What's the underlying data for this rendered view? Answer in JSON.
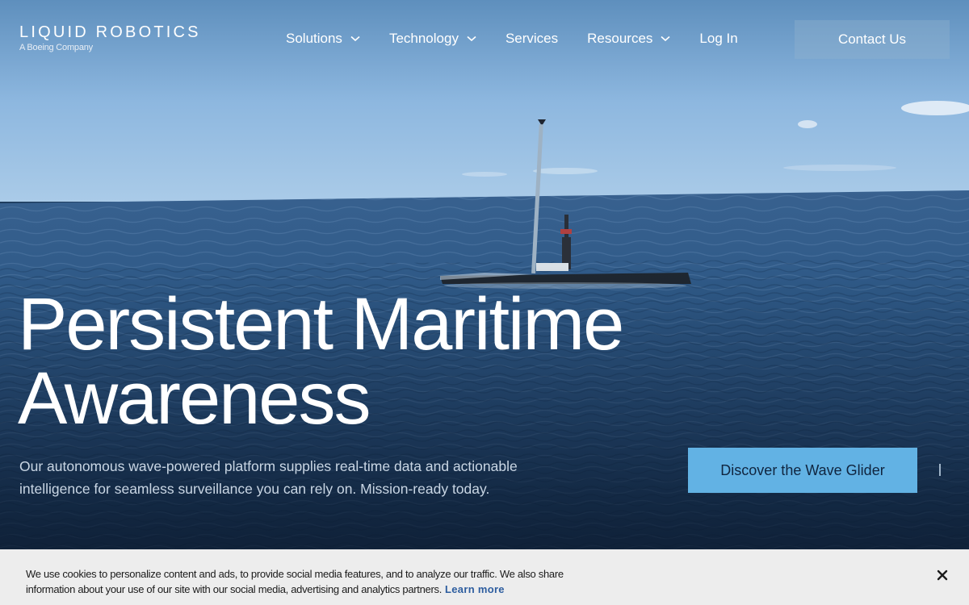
{
  "brand": {
    "name": "LIQUID ROBOTICS",
    "tagline": "A Boeing Company"
  },
  "nav": {
    "items": [
      {
        "label": "Solutions",
        "has_dropdown": true
      },
      {
        "label": "Technology",
        "has_dropdown": true
      },
      {
        "label": "Services",
        "has_dropdown": false
      },
      {
        "label": "Resources",
        "has_dropdown": true
      },
      {
        "label": "Log In",
        "has_dropdown": false
      }
    ],
    "contact_label": "Contact Us"
  },
  "hero": {
    "headline_line1": "Persistent Maritime",
    "headline_line2": "Awareness",
    "subcopy": "Our autonomous wave-powered platform supplies real-time data and actionable intelligence for seamless surveillance you can rely on. Mission-ready today.",
    "cta_label": "Discover the Wave Glider"
  },
  "cookie_banner": {
    "text": "We use cookies to personalize content and ads, to provide social media features, and to analyze our traffic. We also share information about your use of our site with our social media, advertising and analytics partners.",
    "link_label": "Learn more",
    "close_icon": "close-icon"
  },
  "colors": {
    "cta_background": "#62b2e4",
    "cookie_link": "#2d5d9f",
    "contact_background": "rgba(150,180,205,0.35)"
  }
}
